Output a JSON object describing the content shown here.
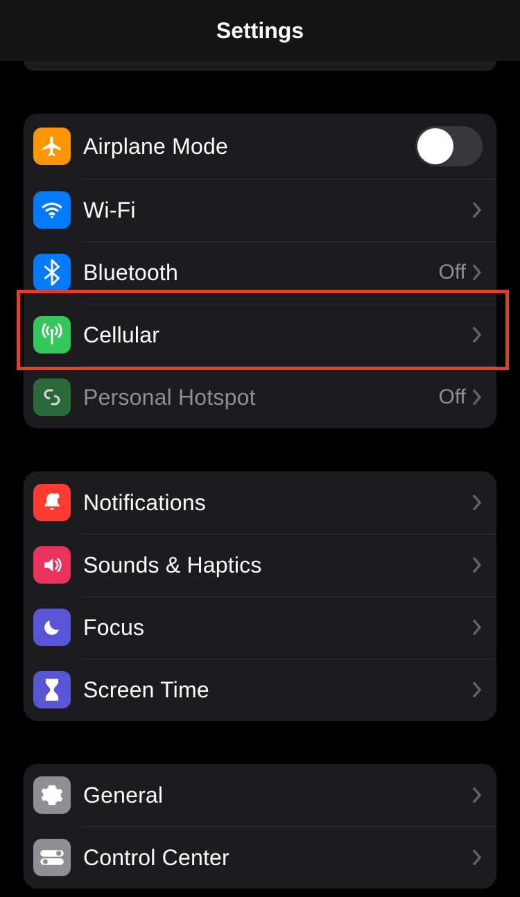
{
  "header": {
    "title": "Settings"
  },
  "groups": [
    {
      "id": "connectivity",
      "rows": [
        {
          "id": "airplane",
          "label": "Airplane Mode",
          "icon": "airplane-icon",
          "icon_color": "c-orange",
          "control": "toggle",
          "toggle_on": false
        },
        {
          "id": "wifi",
          "label": "Wi-Fi",
          "icon": "wifi-icon",
          "icon_color": "c-blue",
          "control": "disclosure",
          "value": ""
        },
        {
          "id": "bluetooth",
          "label": "Bluetooth",
          "icon": "bluetooth-icon",
          "icon_color": "c-blue",
          "control": "disclosure",
          "value": "Off"
        },
        {
          "id": "cellular",
          "label": "Cellular",
          "icon": "antenna-icon",
          "icon_color": "c-green",
          "control": "disclosure",
          "value": "",
          "highlighted": true
        },
        {
          "id": "hotspot",
          "label": "Personal Hotspot",
          "icon": "link-icon",
          "icon_color": "c-green-dim",
          "control": "disclosure",
          "value": "Off",
          "dim": true
        }
      ]
    },
    {
      "id": "attention",
      "rows": [
        {
          "id": "notifications",
          "label": "Notifications",
          "icon": "bell-icon",
          "icon_color": "c-red",
          "control": "disclosure"
        },
        {
          "id": "sounds",
          "label": "Sounds & Haptics",
          "icon": "speaker-icon",
          "icon_color": "c-pink",
          "control": "disclosure"
        },
        {
          "id": "focus",
          "label": "Focus",
          "icon": "moon-icon",
          "icon_color": "c-indigo",
          "control": "disclosure"
        },
        {
          "id": "screentime",
          "label": "Screen Time",
          "icon": "hourglass-icon",
          "icon_color": "c-indigo",
          "control": "disclosure"
        }
      ]
    },
    {
      "id": "general",
      "rows": [
        {
          "id": "general",
          "label": "General",
          "icon": "gear-icon",
          "icon_color": "c-gray",
          "control": "disclosure"
        },
        {
          "id": "controlcenter",
          "label": "Control Center",
          "icon": "toggles-icon",
          "icon_color": "c-gray",
          "control": "disclosure"
        }
      ]
    }
  ]
}
